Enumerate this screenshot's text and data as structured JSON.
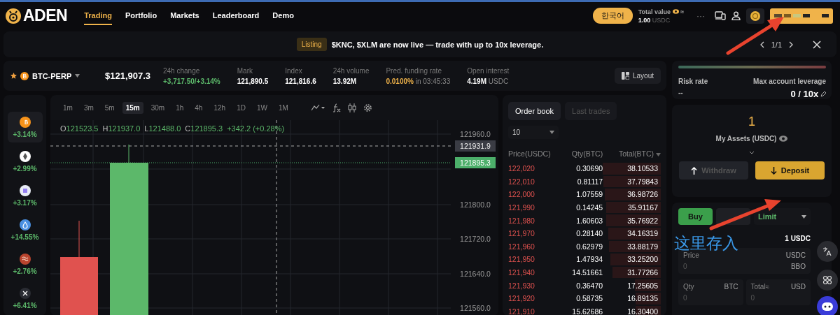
{
  "header": {
    "logo": "ADEN",
    "nav": [
      {
        "label": "Trading",
        "selected": true
      },
      {
        "label": "Portfolio",
        "selected": false
      },
      {
        "label": "Markets",
        "selected": false
      },
      {
        "label": "Leaderboard",
        "selected": false
      },
      {
        "label": "Demo",
        "selected": false
      }
    ],
    "language_button": "한국어",
    "total_value": {
      "label": "Total value",
      "approx": "≈",
      "amount": "1.00",
      "unit": "USDC"
    },
    "more": "···"
  },
  "banner": {
    "tag": "Listing",
    "message": "$KNC, $XLM are now live — trade with up to 10x leverage.",
    "pager": "1/1"
  },
  "ticker": {
    "symbol": "BTC-PERP",
    "price": "$121,907.3",
    "layout_button": "Layout",
    "stats": [
      {
        "label": "24h change",
        "value": "+3,717.50/+3.14%",
        "kind": "up"
      },
      {
        "label": "Mark",
        "value": "121,890.5",
        "kind": "plain"
      },
      {
        "label": "Index",
        "value": "121,816.6",
        "kind": "plain"
      },
      {
        "label": "24h volume",
        "value": "13.92M",
        "kind": "plain"
      },
      {
        "label": "Pred. funding rate",
        "value": "0.0100%",
        "suffix": "in 03:45:33",
        "kind": "rate"
      },
      {
        "label": "Open interest",
        "value": "4.19M",
        "suffix": "USDC",
        "kind": "plain"
      }
    ]
  },
  "coins": [
    {
      "change": "+3.14%",
      "selected": true,
      "color": "#f7931a"
    },
    {
      "change": "+2.99%",
      "selected": false,
      "color": "#ffffff"
    },
    {
      "change": "+3.17%",
      "selected": false,
      "color": "#e8ecf4"
    },
    {
      "change": "+14.55%",
      "selected": false,
      "color": "#4a90e2"
    },
    {
      "change": "+2.76%",
      "selected": false,
      "color": "#b8442e"
    },
    {
      "change": "+6.41%",
      "selected": false,
      "color": "#2a2c33"
    }
  ],
  "chart": {
    "intervals": [
      {
        "label": "1m",
        "selected": false
      },
      {
        "label": "3m",
        "selected": false
      },
      {
        "label": "5m",
        "selected": false
      },
      {
        "label": "15m",
        "selected": true
      },
      {
        "label": "30m",
        "selected": false
      },
      {
        "label": "1h",
        "selected": false
      },
      {
        "label": "4h",
        "selected": false
      },
      {
        "label": "12h",
        "selected": false
      },
      {
        "label": "1D",
        "selected": false
      },
      {
        "label": "1W",
        "selected": false
      },
      {
        "label": "1M",
        "selected": false
      }
    ],
    "ohlc": [
      {
        "key": "O",
        "value": "121523.5"
      },
      {
        "key": "H",
        "value": "121937.0"
      },
      {
        "key": "L",
        "value": "121488.0"
      },
      {
        "key": "C",
        "value": "121895.3"
      }
    ],
    "change": "+342.2 (+0.28%)",
    "price_axis": [
      "121960.0",
      "121800.0",
      "121720.0",
      "121640.0",
      "121560.0"
    ],
    "crosshair_label": "121931.9",
    "last_price_label": "121895.3"
  },
  "order_book": {
    "tabs": [
      {
        "label": "Order book",
        "selected": true
      },
      {
        "label": "Last trades",
        "selected": false
      }
    ],
    "depth": "10",
    "columns": [
      "Price(USDC)",
      "Qty(BTC)",
      "Total(BTC)"
    ],
    "rows": [
      {
        "price": "122,020",
        "qty": "0.30690",
        "total": "38.10533",
        "level": 1.0
      },
      {
        "price": "122,010",
        "qty": "0.81117",
        "total": "37.79843",
        "level": 0.99
      },
      {
        "price": "122,000",
        "qty": "1.07559",
        "total": "36.98726",
        "level": 0.97
      },
      {
        "price": "121,990",
        "qty": "0.14245",
        "total": "35.91167",
        "level": 0.94
      },
      {
        "price": "121,980",
        "qty": "1.60603",
        "total": "35.76922",
        "level": 0.94
      },
      {
        "price": "121,970",
        "qty": "0.28140",
        "total": "34.16319",
        "level": 0.9
      },
      {
        "price": "121,960",
        "qty": "0.62979",
        "total": "33.88179",
        "level": 0.89
      },
      {
        "price": "121,950",
        "qty": "1.47934",
        "total": "33.25200",
        "level": 0.87
      },
      {
        "price": "121,940",
        "qty": "14.51661",
        "total": "31.77266",
        "level": 0.83
      },
      {
        "price": "121,930",
        "qty": "0.36470",
        "total": "17.25605",
        "level": 0.45
      },
      {
        "price": "121,920",
        "qty": "0.58735",
        "total": "16.89135",
        "level": 0.44
      },
      {
        "price": "121,910",
        "qty": "15.62686",
        "total": "16.30400",
        "level": 0.43
      }
    ]
  },
  "risk": {
    "risk_rate_label": "Risk rate",
    "risk_rate": "--",
    "leverage_label": "Max account leverage",
    "leverage": "0 / 10x"
  },
  "assets": {
    "amount": "1",
    "label": "My Assets (USDC)",
    "withdraw": "Withdraw",
    "deposit": "Deposit"
  },
  "order_form": {
    "sides": [
      {
        "label": "Buy",
        "selected": true
      },
      {
        "selected": false
      }
    ],
    "order_type": "Limit",
    "available": "1 USDC",
    "fields": [
      {
        "label": "Price",
        "placeholder": "0",
        "unit": "USDC",
        "extra": "BBO"
      },
      {
        "label": "Qty",
        "placeholder": "0",
        "unit": "BTC"
      },
      {
        "label": "Total≈",
        "placeholder": "0",
        "unit": "USD"
      }
    ]
  },
  "annotation": {
    "text": "这里存入"
  }
}
